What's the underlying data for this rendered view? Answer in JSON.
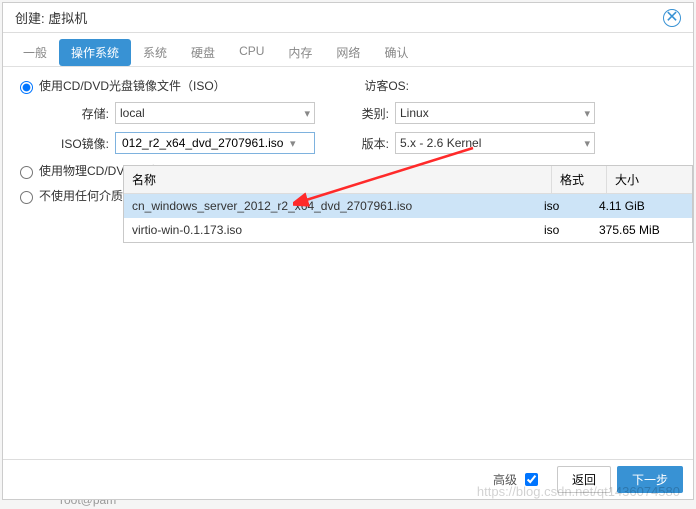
{
  "dialog": {
    "title": "创建: 虚拟机"
  },
  "tabs": {
    "general": "一般",
    "os": "操作系统",
    "system": "系统",
    "disk": "硬盘",
    "cpu": "CPU",
    "memory": "内存",
    "network": "网络",
    "confirm": "确认"
  },
  "radios": {
    "use_iso": "使用CD/DVD光盘镜像文件（ISO）",
    "use_phys": "使用物理CD/DVD驱动器",
    "use_none": "不使用任何介质"
  },
  "fields": {
    "storage_label": "存储:",
    "storage_value": "local",
    "iso_label": "ISO镜像:",
    "iso_value": "012_r2_x64_dvd_2707961.iso",
    "guest_os_label": "访客OS:",
    "category_label": "类别:",
    "category_value": "Linux",
    "version_label": "版本:",
    "version_value": "5.x - 2.6 Kernel"
  },
  "dropdown": {
    "head_name": "名称",
    "head_format": "格式",
    "head_size": "大小",
    "rows": [
      {
        "name": "cn_windows_server_2012_r2_x64_dvd_2707961.iso",
        "format": "iso",
        "size": "4.11 GiB"
      },
      {
        "name": "virtio-win-0.1.173.iso",
        "format": "iso",
        "size": "375.65 MiB"
      }
    ]
  },
  "footer": {
    "advanced": "高级",
    "back": "返回",
    "next": "下一步"
  },
  "watermark": "https://blog.csdn.net/qt1436074580",
  "bg": {
    "user": "root@pam"
  }
}
